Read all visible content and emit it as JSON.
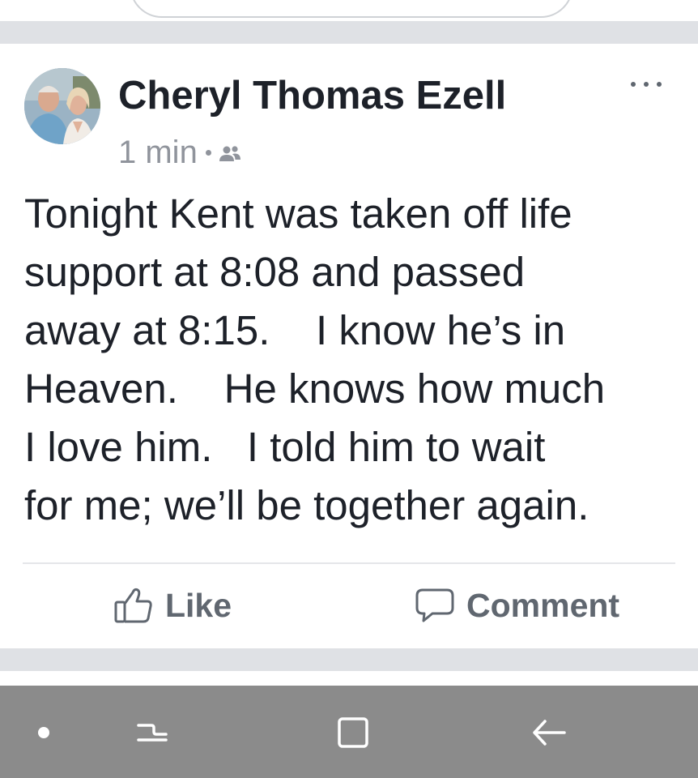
{
  "post": {
    "author": "Cheryl Thomas Ezell",
    "time": "1 min",
    "audience_icon": "friends-icon",
    "body": "Tonight Kent was taken off life\nsupport at 8:08 and passed\naway at 8:15.    I know he’s in\nHeaven.    He knows how much\nI love him.   I told him to wait\nfor me; we’ll be together again.",
    "more_icon": "more-options-icon"
  },
  "actions": {
    "like_label": "Like",
    "comment_label": "Comment"
  },
  "colors": {
    "text_primary": "#1d2129",
    "text_secondary": "#90949c",
    "action_text": "#606770",
    "feed_gap": "#dfe1e5",
    "nav_bar": "#8b8b8b"
  },
  "nav_bar": {
    "items": [
      "dot-icon",
      "recent-apps-icon",
      "home-icon",
      "back-icon"
    ]
  }
}
